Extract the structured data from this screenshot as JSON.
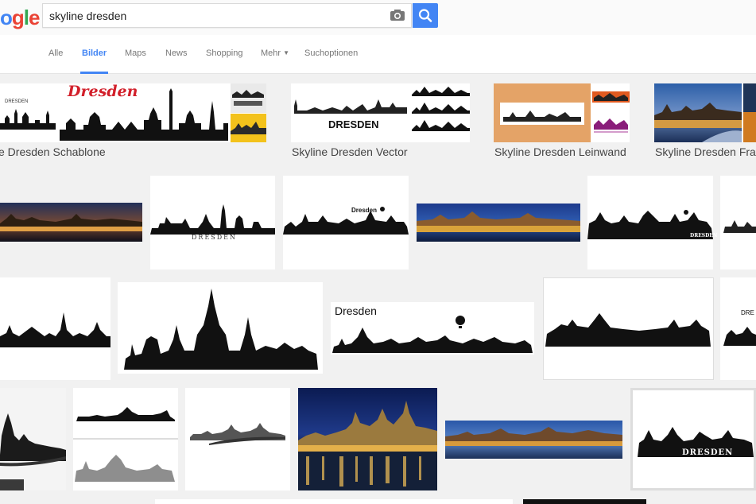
{
  "logo": {
    "text_visible": "ogle"
  },
  "search": {
    "query": "skyline dresden"
  },
  "tabs": [
    {
      "label": "Alle"
    },
    {
      "label": "Bilder"
    },
    {
      "label": "Maps"
    },
    {
      "label": "News"
    },
    {
      "label": "Shopping"
    },
    {
      "label": "Mehr"
    },
    {
      "label": "Suchoptionen"
    }
  ],
  "related": [
    {
      "label": "e Dresden Schablone",
      "card_text": "Dresden",
      "tiny_text": "DRESDEN"
    },
    {
      "label": "Skyline Dresden Vector",
      "card_text": "DRESDEN"
    },
    {
      "label": "Skyline Dresden Leinwand"
    },
    {
      "label": "Skyline Dresden Fra"
    }
  ],
  "results": {
    "row1_text": "Dresden",
    "row1_caption": "DRESDEN",
    "row1_caption2": "DRESDEN",
    "row2_text": "Dresden",
    "row2_text_cut": "DRE",
    "row3_caption": "DRESDEN"
  },
  "colors": {
    "accent": "#4285f4",
    "brand_red": "#d21f2a"
  }
}
